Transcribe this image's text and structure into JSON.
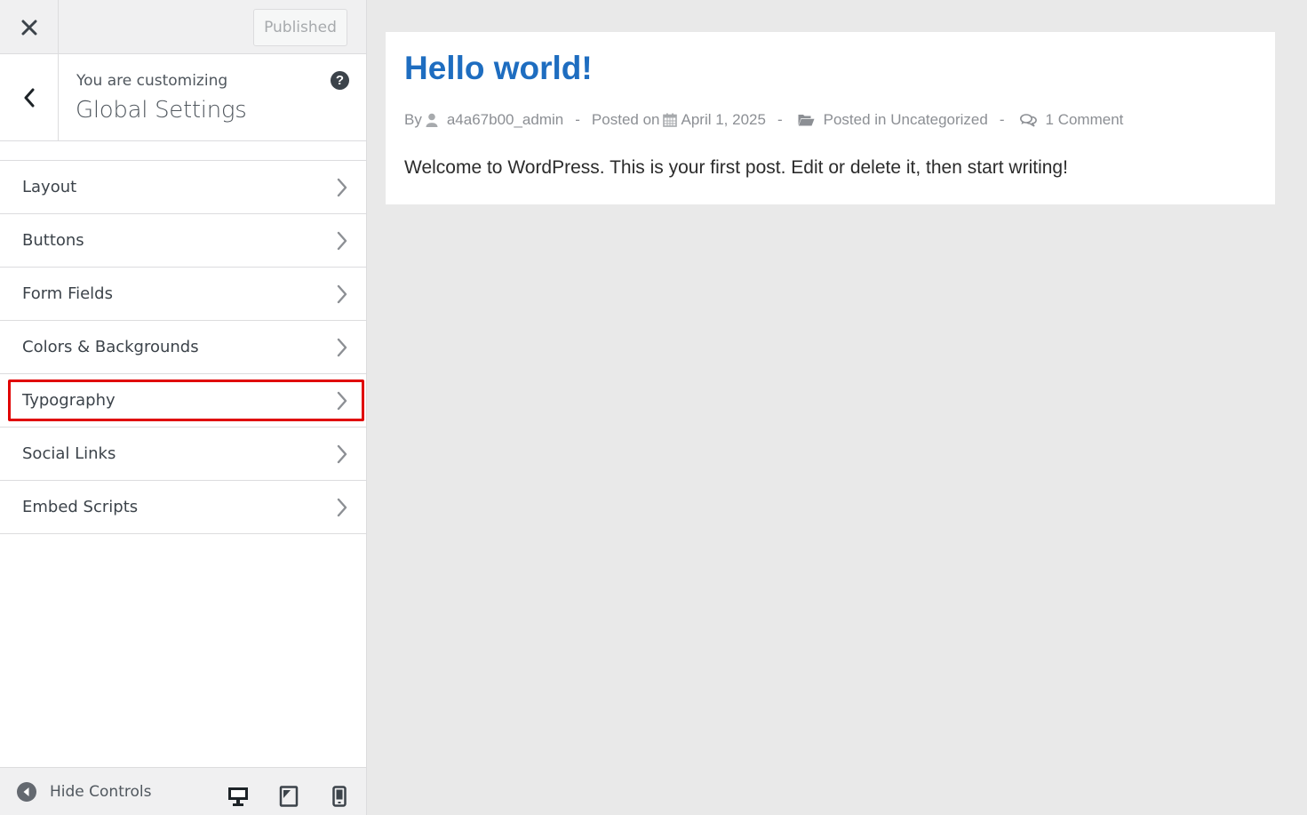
{
  "header": {
    "publish_label": "Published"
  },
  "section": {
    "customizing_label": "You are customizing",
    "title": "Global Settings",
    "help_symbol": "?"
  },
  "menu": {
    "items": [
      {
        "label": "Layout"
      },
      {
        "label": "Buttons"
      },
      {
        "label": "Form Fields"
      },
      {
        "label": "Colors & Backgrounds"
      },
      {
        "label": "Typography",
        "highlighted": true
      },
      {
        "label": "Social Links"
      },
      {
        "label": "Embed Scripts"
      }
    ]
  },
  "footer": {
    "hide_controls_label": "Hide Controls",
    "devices": [
      "desktop-icon",
      "tablet-icon",
      "mobile-icon"
    ]
  },
  "preview": {
    "post": {
      "title": "Hello world!",
      "by_label": "By",
      "author": "a4a67b00_admin",
      "posted_on_label": "Posted on",
      "date": "April 1, 2025",
      "posted_in_label": "Posted in Uncategorized",
      "separator": "-",
      "comments": "1 Comment",
      "content": "Welcome to WordPress. This is your first post. Edit or delete it, then start writing!"
    }
  },
  "colors": {
    "accent": "#1e6dc0",
    "highlight": "#e00000",
    "preview_bg": "#e9e9e9"
  }
}
